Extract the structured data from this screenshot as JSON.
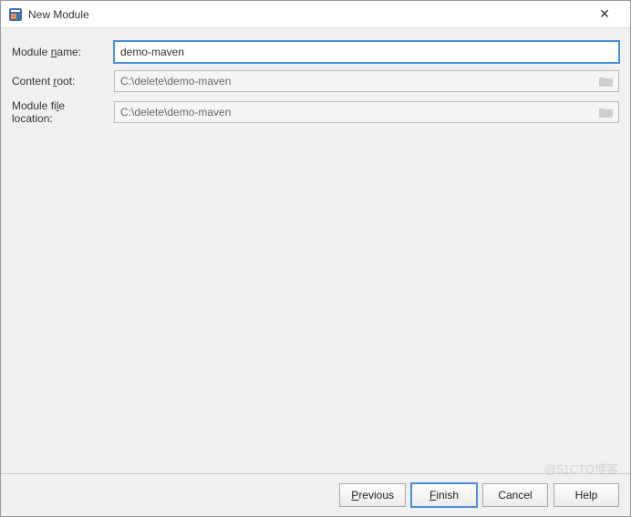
{
  "window": {
    "title": "New Module"
  },
  "form": {
    "module_name": {
      "label": "Module name:",
      "value": "demo-maven"
    },
    "content_root": {
      "label": "Content root:",
      "value": "C:\\delete\\demo-maven"
    },
    "module_file_location": {
      "label": "Module file location:",
      "value": "C:\\delete\\demo-maven"
    }
  },
  "buttons": {
    "previous": "Previous",
    "finish": "Finish",
    "cancel": "Cancel",
    "help": "Help"
  },
  "watermark": "@51CTO博客"
}
